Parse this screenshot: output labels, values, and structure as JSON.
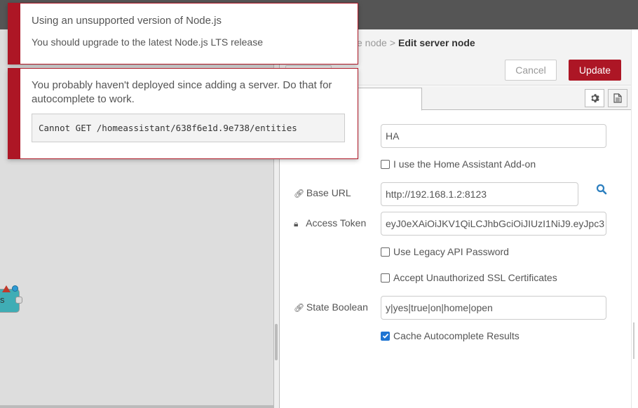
{
  "notifications": [
    {
      "title": "Using an unsupported version of Node.js",
      "body": "You should upgrade to the latest Node.js LTS release"
    },
    {
      "message": "You probably haven't deployed since adding a server. Do that for autocomplete to work.",
      "code": "Cannot GET /homeassistant/638f6e1d.9e738/entities"
    }
  ],
  "workspace": {
    "node_label": "s"
  },
  "editor": {
    "breadcrumb": {
      "parent": "e node",
      "separator": ">",
      "current": "Edit server node"
    },
    "buttons": {
      "cancel": "Cancel",
      "update": "Update"
    },
    "tab_icons": {
      "settings": "gear-icon",
      "description": "document-icon"
    },
    "form": {
      "name_value": "HA",
      "addon_label": "I use the Home Assistant Add-on",
      "addon_checked": false,
      "base_url_label": "Base URL",
      "base_url_value": "http://192.168.1.2:8123",
      "access_token_label": "Access Token",
      "access_token_value": "eyJ0eXAiOiJKV1QiLCJhbGciOiJIUzI1NiJ9.eyJpc3",
      "legacy_label": "Use Legacy API Password",
      "legacy_checked": false,
      "ssl_label": "Accept Unauthorized SSL Certificates",
      "ssl_checked": false,
      "state_boolean_label": "State Boolean",
      "state_boolean_value": "y|yes|true|on|home|open",
      "cache_label": "Cache Autocomplete Results",
      "cache_checked": true
    }
  },
  "colors": {
    "accent_red": "#AD1625",
    "checkbox_blue": "#1E74D2",
    "search_icon_blue": "#2C7FBF"
  }
}
